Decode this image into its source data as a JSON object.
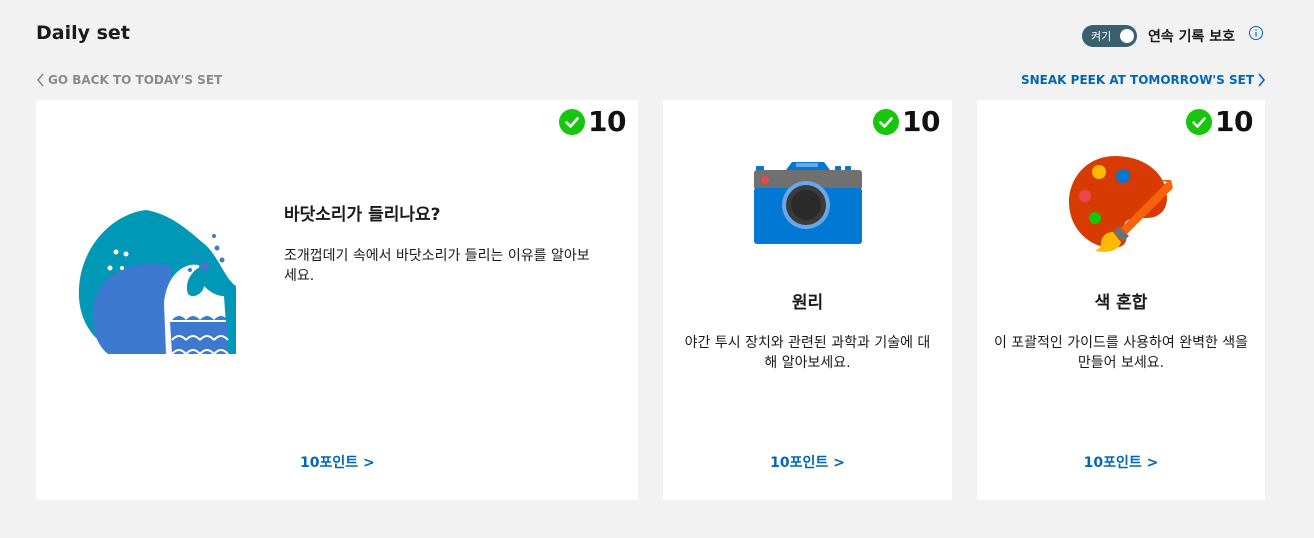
{
  "header": {
    "title": "Daily set",
    "toggle_label": "켜기",
    "streak_label": "연속 기록 보호"
  },
  "nav": {
    "back_label": "GO BACK TO TODAY'S SET",
    "next_label": "SNEAK PEEK AT TOMORROW'S SET"
  },
  "cards": [
    {
      "points": "10",
      "title": "바닷소리가 들리나요?",
      "description": "조개껍데기 속에서 바닷소리가 들리는 이유를 알아보세요.",
      "link": "10포인트 >",
      "icon": "wave-icon"
    },
    {
      "points": "10",
      "title": "원리",
      "description": "야간 투시 장치와 관련된 과학과 기술에 대해 알아보세요.",
      "link": "10포인트 >",
      "icon": "camera-icon"
    },
    {
      "points": "10",
      "title": "색 혼합",
      "description": "이 포괄적인 가이드를 사용하여 완벽한 색을 만들어 보세요.",
      "link": "10포인트 >",
      "icon": "palette-icon"
    }
  ],
  "colors": {
    "background": "#f2f2f2",
    "accent_link": "#0067b8",
    "check_green": "#16c60c",
    "toggle_bg": "#3a5f6e"
  }
}
